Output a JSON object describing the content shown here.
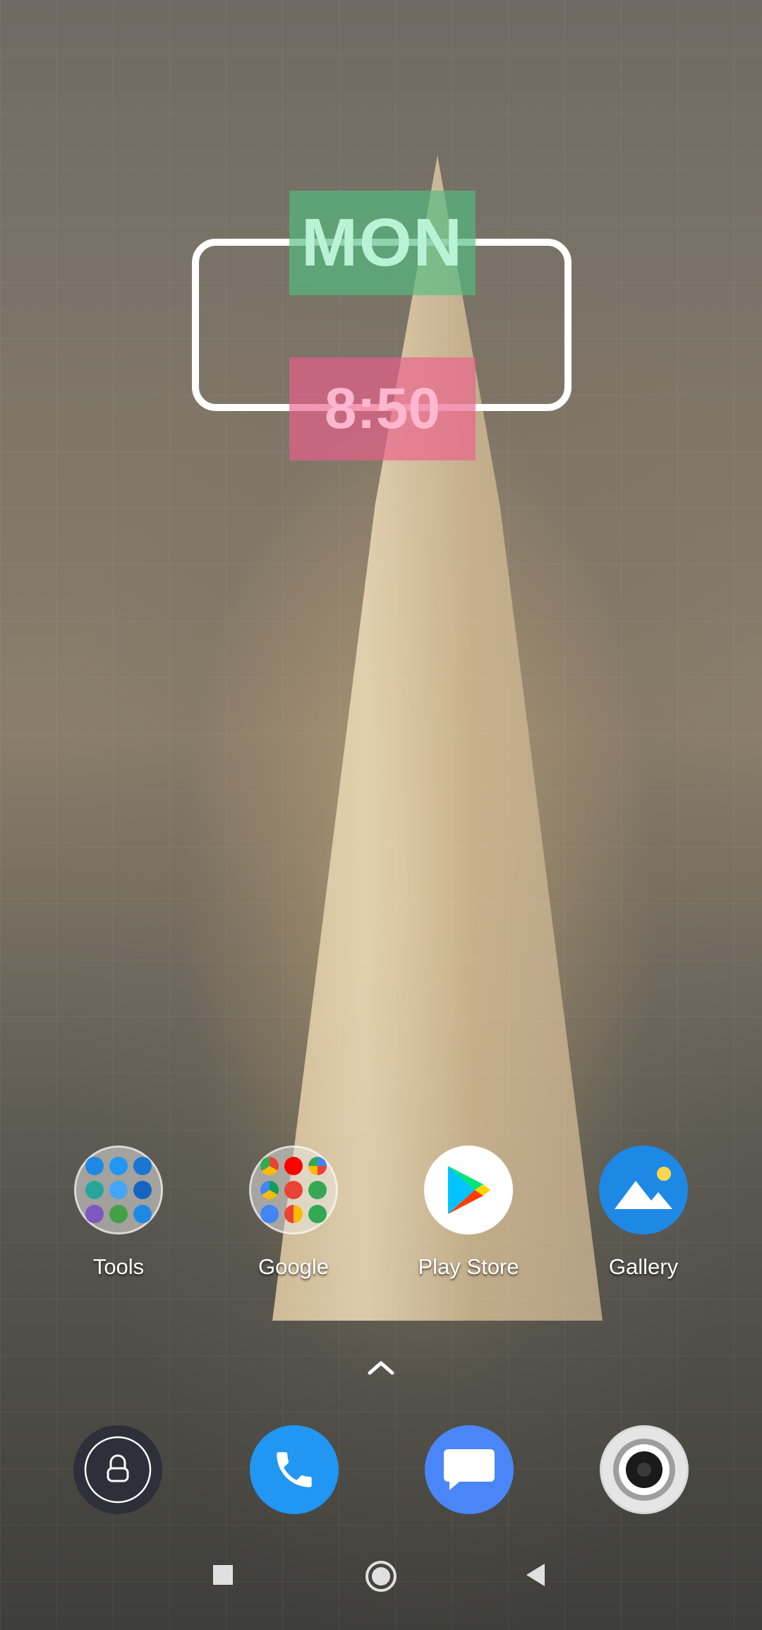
{
  "widget": {
    "day": "MON",
    "time": "8:50"
  },
  "apps": [
    {
      "label": "Tools",
      "icon": "tools-folder-icon"
    },
    {
      "label": "Google",
      "icon": "google-folder-icon"
    },
    {
      "label": "Play Store",
      "icon": "play-store-icon"
    },
    {
      "label": "Gallery",
      "icon": "gallery-icon"
    }
  ],
  "dock": [
    {
      "icon": "lock-icon"
    },
    {
      "icon": "phone-icon"
    },
    {
      "icon": "messages-icon"
    },
    {
      "icon": "camera-icon"
    }
  ],
  "navigation": {
    "recent": "recent-apps-icon",
    "home": "home-icon",
    "back": "back-icon"
  },
  "colors": {
    "day_box": "#52bd82",
    "time_box": "#eb5f8c",
    "phone": "#2196f3",
    "messages": "#4a86f7",
    "gallery": "#1e88e5"
  }
}
